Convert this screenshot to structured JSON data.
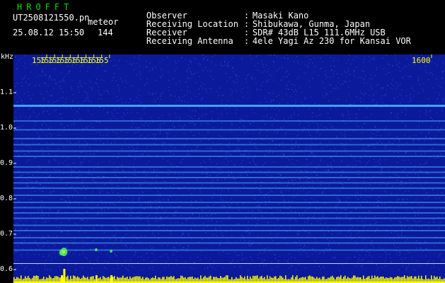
{
  "header": {
    "app_title": "HROFFT",
    "file_name": "UT2508121550.pn",
    "file_ext": "meteor",
    "datetime": "25.08.12 15:50",
    "count": "144",
    "info": [
      {
        "label": "Observer",
        "value": "Masaki Kano"
      },
      {
        "label": "Receiving Location",
        "value": "Shibukawa, Gunma, Japan"
      },
      {
        "label": "Receiver",
        "value": "SDR# 43dB L15 111.6MHz USB"
      },
      {
        "label": "Receiving Antenna",
        "value": "4ele Yagi Az 230 for Kansai VOR"
      }
    ]
  },
  "axes": {
    "y_unit": "kHz",
    "y_ticks": [
      {
        "label": "1.1",
        "value": 1.1
      },
      {
        "label": "1.0",
        "value": 1.0
      },
      {
        "label": "0.9",
        "value": 0.9
      },
      {
        "label": "0.8",
        "value": 0.8
      },
      {
        "label": "0.7",
        "value": 0.7
      },
      {
        "label": "0.6",
        "value": 0.6
      }
    ],
    "x_ticks": [
      {
        "label": "155",
        "value": 1551
      },
      {
        "label": "155",
        "value": 1552
      },
      {
        "label": "155",
        "value": 1553
      },
      {
        "label": "155",
        "value": 1554
      },
      {
        "label": "155",
        "value": 1555
      },
      {
        "label": "155",
        "value": 1556
      },
      {
        "label": "155",
        "value": 1557
      },
      {
        "label": "155",
        "value": 1558
      },
      {
        "label": "155",
        "value": 1559
      },
      {
        "label": "1600",
        "value": 1600
      }
    ]
  },
  "spectrogram": {
    "background_color": "#0a1a9a",
    "carrier_color": "#4aa8ff",
    "meteor_color": "#40ff60",
    "strong_band_khz": 1.063,
    "band_khz": [
      1.02,
      0.995,
      0.97,
      0.953,
      0.935,
      0.92,
      0.89,
      0.875,
      0.86,
      0.845,
      0.83,
      0.81,
      0.79,
      0.775,
      0.76,
      0.745,
      0.725,
      0.71,
      0.69,
      0.675,
      0.655
    ],
    "reference_khz": 0.617,
    "meteor_echoes": [
      {
        "time_min": 1552.9,
        "khz": 0.648,
        "strength": "medium"
      },
      {
        "time_min": 1553.2,
        "khz": 0.65,
        "strength": "strong"
      },
      {
        "time_min": 1557.3,
        "khz": 0.656,
        "strength": "weak"
      },
      {
        "time_min": 1559.2,
        "khz": 0.652,
        "strength": "weak"
      }
    ]
  }
}
